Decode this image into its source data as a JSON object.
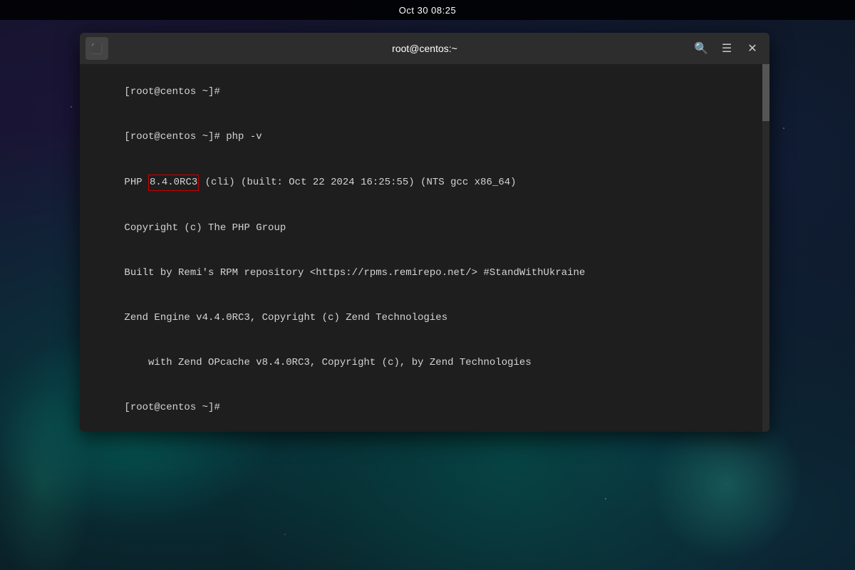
{
  "taskbar": {
    "clock": "Oct 30  08:25"
  },
  "terminal": {
    "title": "root@centos:~",
    "lines": [
      {
        "id": "line1",
        "text": "[root@centos ~]#"
      },
      {
        "id": "line2",
        "text": "[root@centos ~]# php -v"
      },
      {
        "id": "line3_prefix",
        "text": "PHP "
      },
      {
        "id": "line3_version",
        "text": "8.4.0RC3"
      },
      {
        "id": "line3_suffix",
        "text": " (cli) (built: Oct 22 2024 16:25:55) (NTS gcc x86_64)"
      },
      {
        "id": "line4",
        "text": "Copyright (c) The PHP Group"
      },
      {
        "id": "line5",
        "text": "Built by Remi's RPM repository <https://rpms.remirepo.net/> #StandWithUkraine"
      },
      {
        "id": "line6",
        "text": "Zend Engine v4.4.0RC3, Copyright (c) Zend Technologies"
      },
      {
        "id": "line7",
        "text": "    with Zend OPcache v8.4.0RC3, Copyright (c), by Zend Technologies"
      },
      {
        "id": "line8",
        "text": "[root@centos ~]#"
      },
      {
        "id": "line9",
        "text": "[root@centos ~]#"
      }
    ],
    "buttons": {
      "search": "🔍",
      "menu": "☰",
      "close": "✕"
    }
  }
}
